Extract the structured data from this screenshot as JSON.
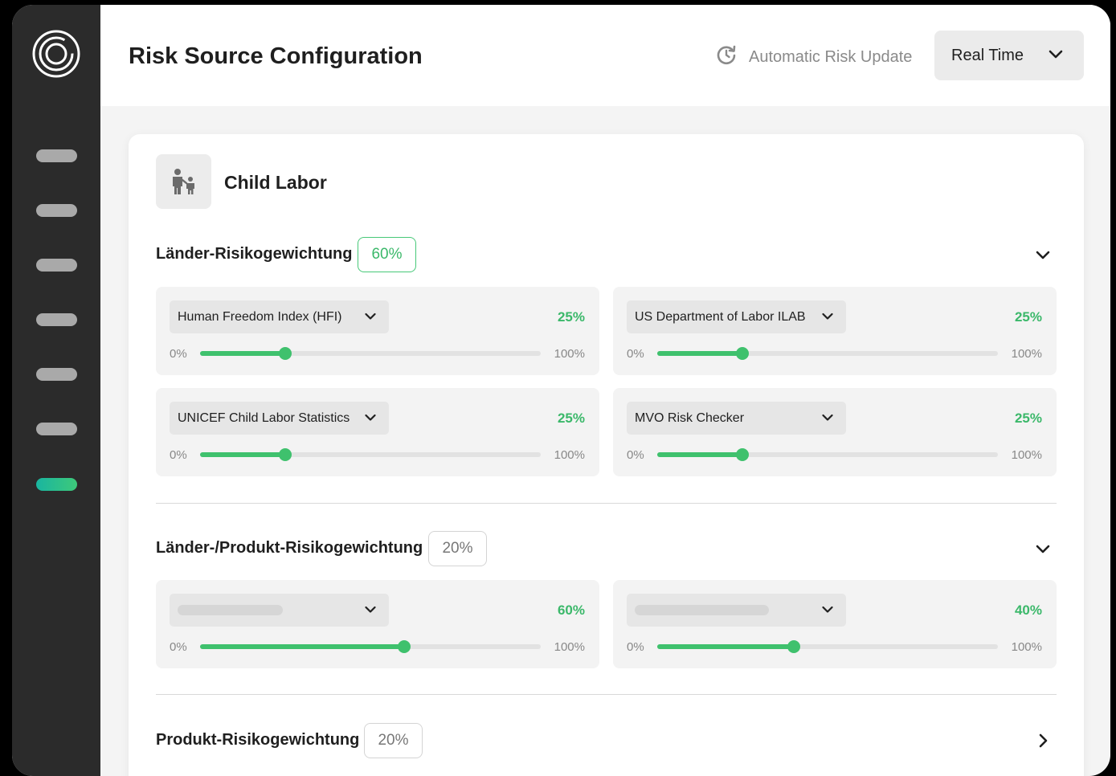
{
  "header": {
    "title": "Risk Source Configuration",
    "auto_update_label": "Automatic Risk Update",
    "update_mode": "Real Time"
  },
  "category": {
    "title": "Child Labor",
    "icon": "parent-child-icon"
  },
  "sections": [
    {
      "label": "Länder-Risikogewichtung",
      "weight": "60%",
      "expanded": true,
      "sources": [
        {
          "name": "Human Freedom Index (HFI)",
          "value_label": "25%",
          "value": 0.25,
          "min": "0%",
          "max": "100%"
        },
        {
          "name": "US Department of Labor ILAB",
          "value_label": "25%",
          "value": 0.25,
          "min": "0%",
          "max": "100%"
        },
        {
          "name": "UNICEF Child Labor Statistics",
          "value_label": "25%",
          "value": 0.25,
          "min": "0%",
          "max": "100%"
        },
        {
          "name": "MVO Risk Checker",
          "value_label": "25%",
          "value": 0.25,
          "min": "0%",
          "max": "100%"
        }
      ]
    },
    {
      "label": "Länder-/Produkt-Risikogewichtung",
      "weight": "20%",
      "expanded": true,
      "sources": [
        {
          "name": "",
          "value_label": "60%",
          "value": 0.6,
          "min": "0%",
          "max": "100%"
        },
        {
          "name": "",
          "value_label": "40%",
          "value": 0.4,
          "min": "0%",
          "max": "100%"
        }
      ]
    },
    {
      "label": "Produkt-Risikogewichtung",
      "weight": "20%",
      "expanded": false
    }
  ],
  "colors": {
    "accent": "#3fc16d",
    "sidebar": "#2b2b2b",
    "nav_active_start": "#19b5a0",
    "nav_active_end": "#3ec97a"
  },
  "icons": [
    "logo-rings-icon",
    "refresh-clock-icon",
    "chevron-down-icon",
    "chevron-right-icon",
    "parent-child-icon"
  ]
}
